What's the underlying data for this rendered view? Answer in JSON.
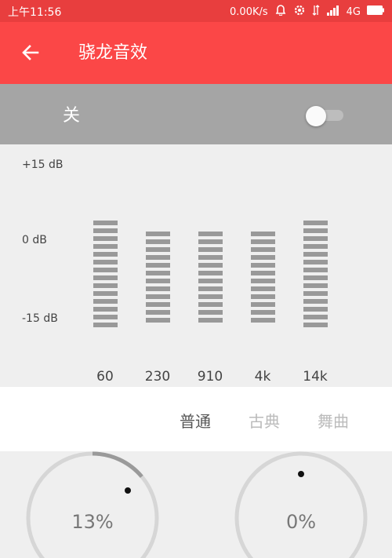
{
  "status_bar": {
    "time": "上午11:56",
    "net_speed": "0.00K/s",
    "network": "4G"
  },
  "app_bar": {
    "back_icon": "arrow-left-icon",
    "title": "骁龙音效"
  },
  "toggle": {
    "label": "关",
    "state_on": false
  },
  "equalizer": {
    "db_labels": {
      "top": "+15 dB",
      "mid": "0 dB",
      "bottom": "-15 dB"
    },
    "bands": [
      {
        "freq": "60"
      },
      {
        "freq": "230"
      },
      {
        "freq": "910"
      },
      {
        "freq": "4k"
      },
      {
        "freq": "14k"
      }
    ]
  },
  "presets": [
    {
      "label": "普通",
      "selected": true
    },
    {
      "label": "古典",
      "selected": false
    },
    {
      "label": "舞曲",
      "selected": false
    }
  ],
  "knobs": [
    {
      "value_text": "13%",
      "value": 13
    },
    {
      "value_text": "0%",
      "value": 0
    }
  ],
  "colors": {
    "status_bar": "#e83e3e",
    "app_bar": "#fb4747",
    "toggle_bar": "#a5a5a5",
    "eq_bar": "#999999",
    "preset_selected": "#555555",
    "preset_unselected": "#bbbbbb"
  }
}
